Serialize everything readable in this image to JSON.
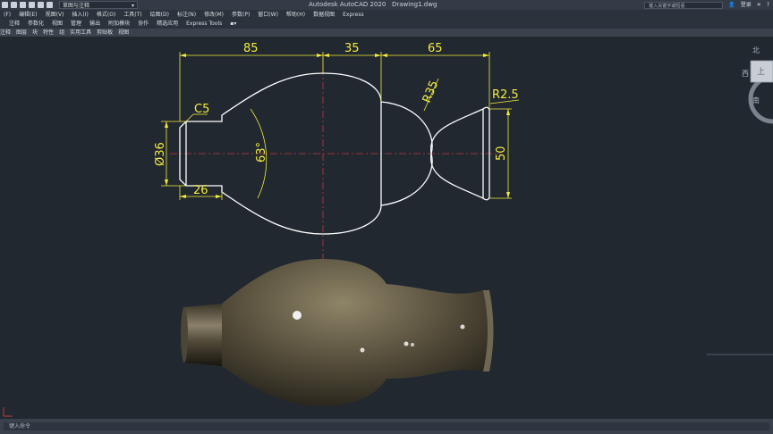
{
  "titlebar": {
    "workspace": "草图与注释",
    "app_title": "Autodesk AutoCAD 2020",
    "file_name": "Drawing1.dwg",
    "search_placeholder": "键入关键字或短语",
    "login_label": "登录"
  },
  "menubar": {
    "items": [
      "(F)",
      "编辑(E)",
      "视图(V)",
      "插入(I)",
      "格式(O)",
      "工具(T)",
      "绘图(D)",
      "标注(N)",
      "修改(M)",
      "参数(P)",
      "窗口(W)",
      "帮助(H)",
      "数据视图",
      "Express"
    ]
  },
  "ribbon": {
    "tabs": [
      "注释",
      "参数化",
      "视图",
      "管理",
      "输出",
      "附加模块",
      "协作",
      "精选应用",
      "Express Tools"
    ],
    "panels": [
      "注释",
      "图层",
      "块",
      "特性",
      "组",
      "实用工具",
      "剪贴板",
      "视图"
    ]
  },
  "drawing": {
    "dimensions": [
      "85",
      "35",
      "65",
      "C5",
      "R35",
      "R2.5",
      "Ø36",
      "63°",
      "26",
      "50"
    ]
  },
  "viewcube": {
    "north": "北",
    "west": "西",
    "top": "上",
    "south": "南"
  },
  "command": {
    "placeholder": "键入命令"
  },
  "colors": {
    "background": "#212830",
    "dimension": "#f4ec3c",
    "outline": "#ffffff",
    "centerline": "#c23a3a"
  }
}
